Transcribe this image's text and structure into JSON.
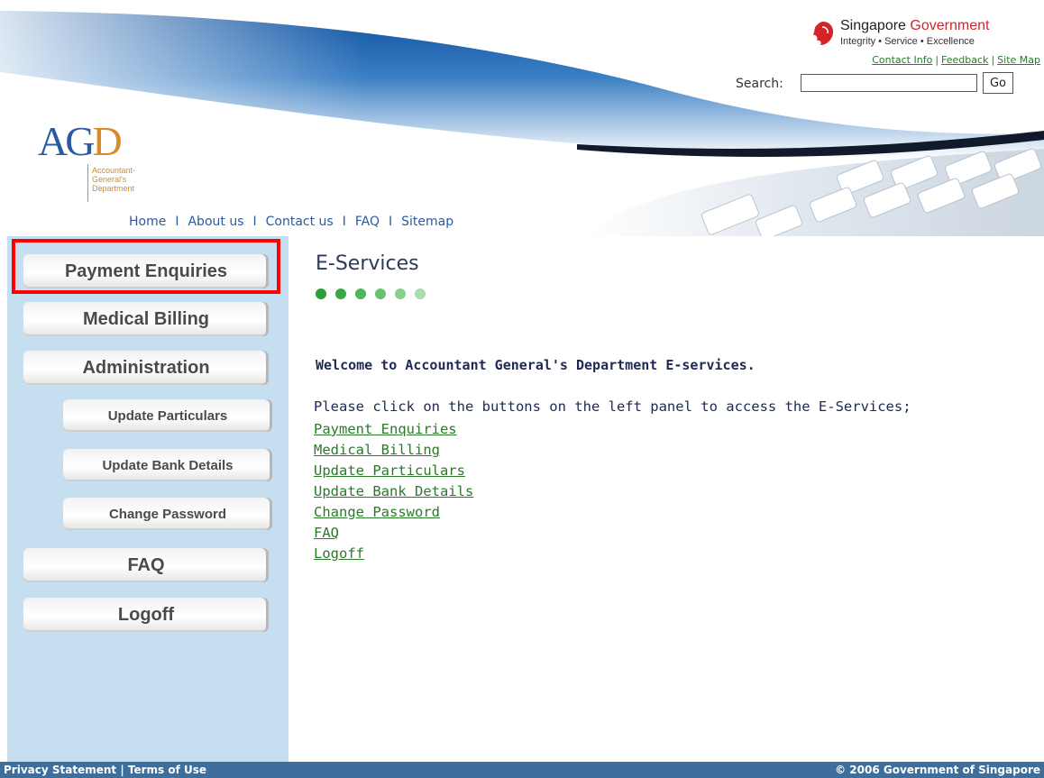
{
  "header": {
    "gov_title_1": "Singapore",
    "gov_title_2": "Government",
    "gov_tagline": "Integrity • Service • Excellence",
    "top_links": [
      "Contact Info",
      "Feedback",
      "Site Map"
    ],
    "search_label": "Search:",
    "search_value": "",
    "search_button": "Go",
    "agd_letters_ag": "AG",
    "agd_letters_d": "D",
    "agd_sub": [
      "Accountant-",
      "General's",
      "Department"
    ]
  },
  "topnav": {
    "items": [
      "Home",
      "About us",
      "Contact us",
      "FAQ",
      "Sitemap"
    ],
    "separator": "I"
  },
  "sidebar": {
    "buttons": [
      "Payment Enquiries",
      "Medical Billing",
      "Administration",
      "Update Particulars",
      "Update Bank Details",
      "Change Password",
      "FAQ",
      "Logoff"
    ]
  },
  "main": {
    "title": "E-Services",
    "dot_colors": [
      "#2e9e3a",
      "#39a944",
      "#4fb659",
      "#68c270",
      "#86cf8c",
      "#a7dcab"
    ],
    "welcome": "Welcome to Accountant General's Department E-services.",
    "instructions": "Please click on the buttons on the left panel to access the E-Services;",
    "links": [
      "Payment Enquiries",
      "Medical Billing",
      "Update Particulars",
      "Update Bank Details",
      "Change Password",
      "FAQ",
      "Logoff"
    ]
  },
  "footer": {
    "privacy": "Privacy Statement",
    "sep": "|",
    "terms": "Terms of Use",
    "copyright": "© 2006 Government of Singapore"
  },
  "colors": {
    "header_blue": "#1f5fa8",
    "sidebar_bg": "#c5dff0",
    "link_green": "#2a7a2a",
    "footer_bg": "#3d6e9c",
    "highlight_red": "#ff0000"
  }
}
